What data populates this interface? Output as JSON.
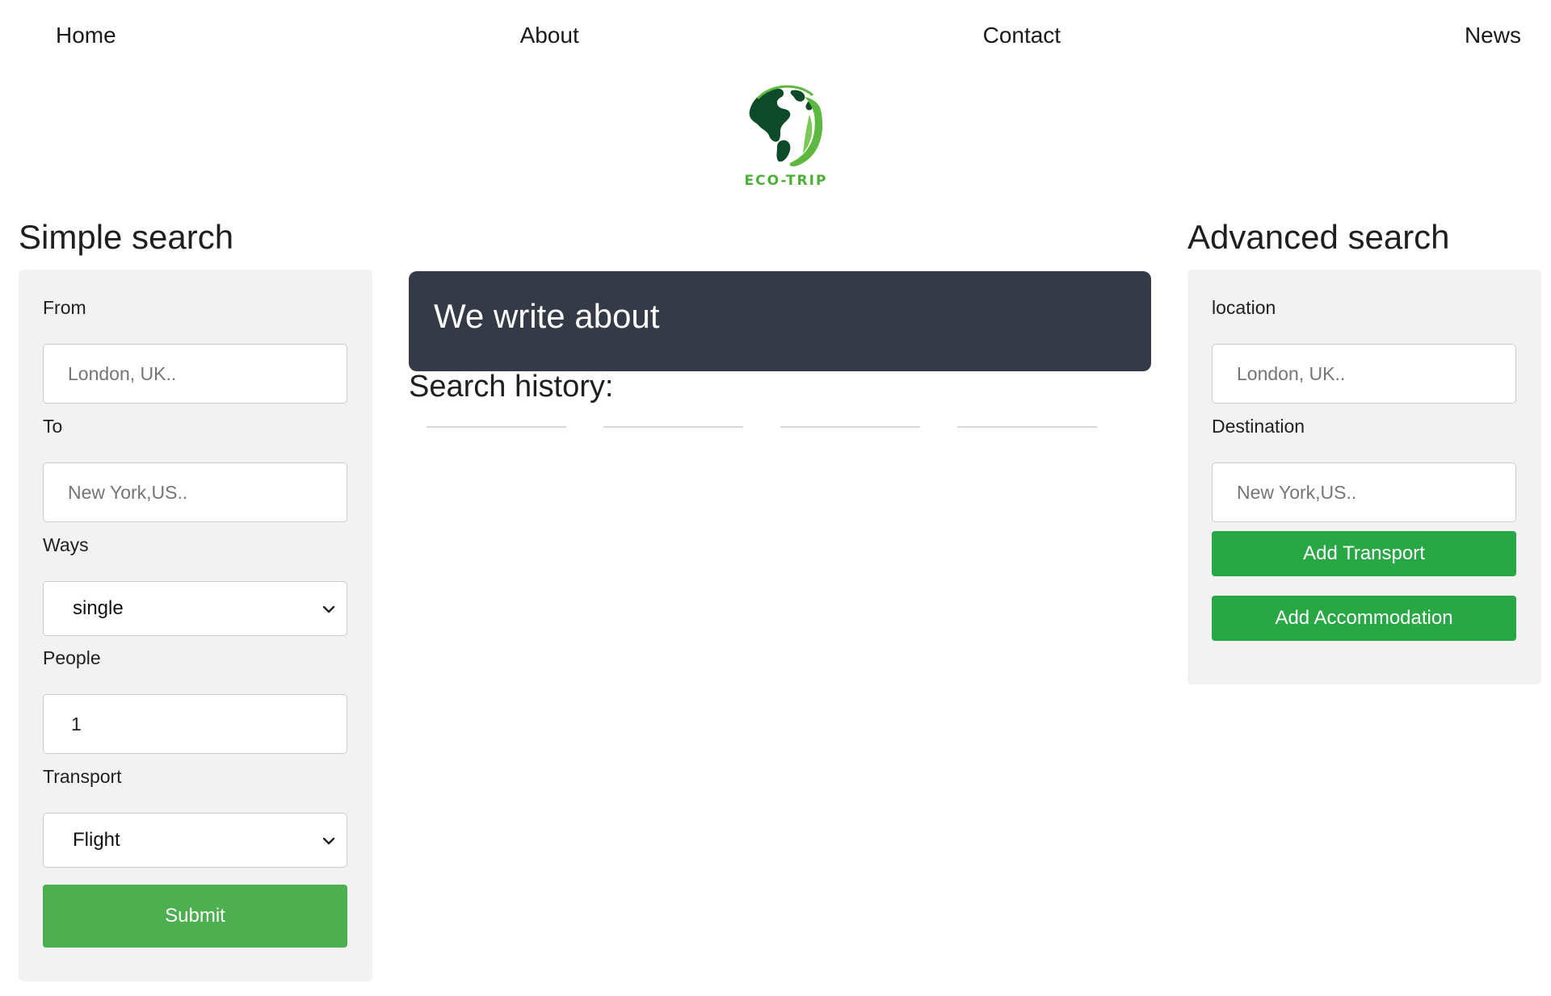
{
  "nav": {
    "items": [
      {
        "label": "Home"
      },
      {
        "label": "About"
      },
      {
        "label": "Contact"
      },
      {
        "label": "News"
      }
    ]
  },
  "logo": {
    "text": "ECO-TRIP",
    "icon": "globe-leaf-icon",
    "colors": {
      "globe": "#0d4a2a",
      "leaf": "#5cb83e"
    }
  },
  "simple_search": {
    "title": "Simple search",
    "from": {
      "label": "From",
      "placeholder": "London, UK..",
      "value": ""
    },
    "to": {
      "label": "To",
      "placeholder": "New York,US..",
      "value": ""
    },
    "ways": {
      "label": "Ways",
      "selected": "single"
    },
    "people": {
      "label": "People",
      "value": "1"
    },
    "transport": {
      "label": "Transport",
      "selected": "Flight"
    },
    "submit_label": "Submit"
  },
  "center": {
    "banner_text": "We write about",
    "history_title": "Search history:",
    "history_items": [
      "",
      "",
      "",
      ""
    ]
  },
  "advanced_search": {
    "title": "Advanced search",
    "location": {
      "label": "location",
      "placeholder": "London, UK..",
      "value": ""
    },
    "destination": {
      "label": "Destination",
      "placeholder": "New York,US..",
      "value": ""
    },
    "add_transport_label": "Add Transport",
    "add_accommodation_label": "Add Accommodation"
  },
  "colors": {
    "submit_button": "#4caf50",
    "action_buttons": "#28a745",
    "banner": "#343a46",
    "panel_bg": "#f2f2f2"
  }
}
